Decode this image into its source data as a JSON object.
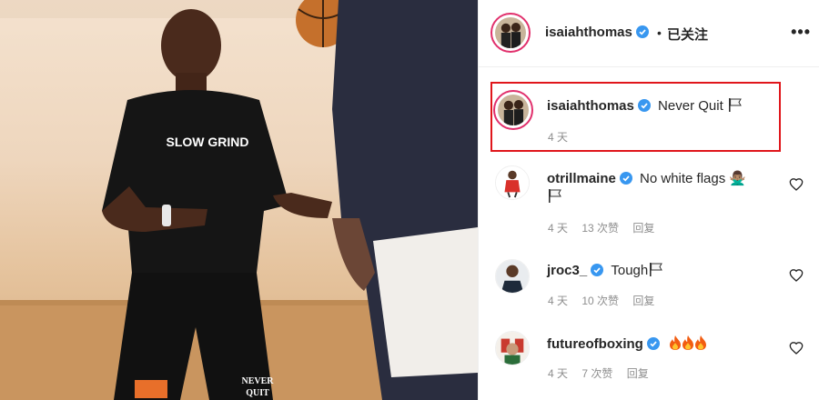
{
  "header": {
    "username": "isaiahthomas",
    "separator": "•",
    "follow_status": "已关注",
    "more_icon": "more-horizontal-icon"
  },
  "photo": {
    "shirt_text": "SLOW GRIND",
    "shorts_text_line1": "NEVER",
    "shorts_text_line2": "QUIT"
  },
  "caption": {
    "username": "isaiahthomas",
    "text": "Never Quit",
    "emoji": "flag-icon",
    "time": "4 天",
    "highlight_color": "#e0161b"
  },
  "comments": [
    {
      "username": "otrillmaine",
      "text": "No white flags 🙅🏽‍♂️",
      "emoji": "flag-icon",
      "time": "4 天",
      "likes": "13 次赞",
      "reply": "回复"
    },
    {
      "username": "jroc3_",
      "text": "Tough",
      "emoji": "flag-icon",
      "time": "4 天",
      "likes": "10 次赞",
      "reply": "回复"
    },
    {
      "username": "futureofboxing",
      "text": "",
      "emoji": "fire-icon",
      "time": "4 天",
      "likes": "7 次赞",
      "reply": "回复"
    }
  ],
  "colors": {
    "verified": "#3897f0",
    "muted": "#8e8e8e",
    "text": "#262626",
    "story_ring": "#e1306c"
  }
}
